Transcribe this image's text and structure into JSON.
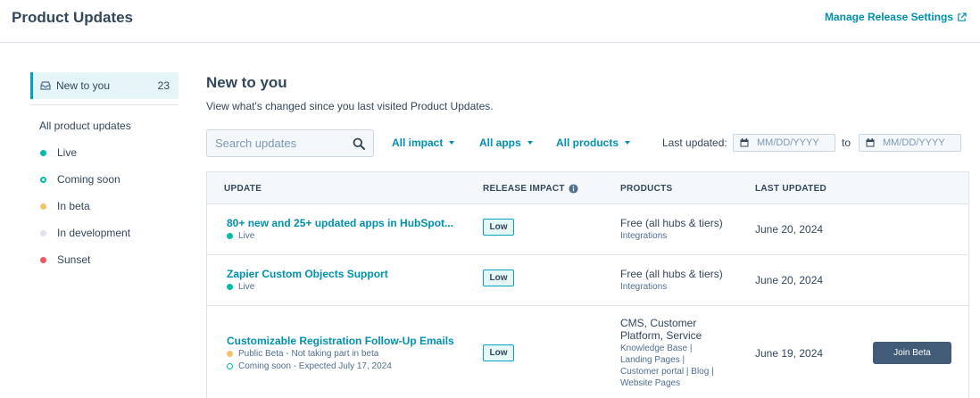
{
  "header": {
    "title": "Product Updates",
    "manage_link": "Manage Release Settings"
  },
  "sidebar": {
    "active": {
      "label": "New to you",
      "count": "23"
    },
    "all_label": "All product updates",
    "items": [
      {
        "label": "Live",
        "color": "#00bda5",
        "hollow": false
      },
      {
        "label": "Coming soon",
        "color": "#00bda5",
        "hollow": true
      },
      {
        "label": "In beta",
        "color": "#f5c26b",
        "hollow": false
      },
      {
        "label": "In development",
        "color": "#dfe3eb",
        "hollow": false
      },
      {
        "label": "Sunset",
        "color": "#f2545b",
        "hollow": false
      }
    ]
  },
  "main": {
    "title": "New to you",
    "subtitle": "View what's changed since you last visited Product Updates.",
    "search_placeholder": "Search updates",
    "filters": [
      "All impact",
      "All apps",
      "All products"
    ],
    "last_updated_label": "Last updated:",
    "date_placeholder": "MM/DD/YYYY",
    "to_label": "to"
  },
  "table": {
    "columns": [
      "UPDATE",
      "RELEASE IMPACT",
      "PRODUCTS",
      "LAST UPDATED"
    ],
    "rows": [
      {
        "title": "80+ new and 25+ updated apps in HubSpot...",
        "statuses": [
          {
            "text": "Live",
            "color": "#00bda5",
            "hollow": false
          }
        ],
        "impact": "Low",
        "products": "Free (all hubs & tiers)",
        "products_sub": "Integrations",
        "updated": "June 20, 2024"
      },
      {
        "title": "Zapier Custom Objects Support",
        "statuses": [
          {
            "text": "Live",
            "color": "#00bda5",
            "hollow": false
          }
        ],
        "impact": "Low",
        "products": "Free (all hubs & tiers)",
        "products_sub": "Integrations",
        "updated": "June 20, 2024"
      },
      {
        "title": "Customizable Registration Follow-Up Emails",
        "statuses": [
          {
            "text": "Public Beta - Not taking part in beta",
            "color": "#f5c26b",
            "hollow": false
          },
          {
            "text": "Coming soon - Expected July 17, 2024",
            "color": "#00bda5",
            "hollow": true
          }
        ],
        "impact": "Low",
        "products_lines": [
          "CMS, Customer",
          "Platform, Service"
        ],
        "products_sub_lines": [
          "Knowledge Base |",
          "Landing Pages |",
          "Customer portal | Blog |",
          "Website Pages"
        ],
        "updated": "June 19, 2024",
        "action": "Join Beta"
      }
    ]
  },
  "colors": {
    "accent": "#0091ae",
    "text": "#33475b",
    "button": "#425b76"
  }
}
